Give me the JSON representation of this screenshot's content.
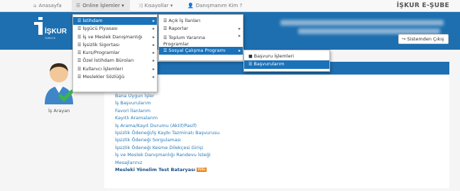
{
  "topnav": {
    "home": "Anasayfa",
    "online": "Online İşlemler",
    "shortcuts": "Kısayollar",
    "advisor": "Danışmanım Kim ?",
    "brand": "İŞKUR E-ŞUBE"
  },
  "header": {
    "logo_text": "İŞKUR",
    "logo_sub": "TÜRKİYE",
    "exit_label": "Sistemden Çıkış"
  },
  "user": {
    "caption": "İş Arayan"
  },
  "menu1": [
    {
      "label": "İstihdam",
      "active": true
    },
    {
      "label": "İşgücü Piyasası"
    },
    {
      "label": "İş ve Meslek Danışmanlığı"
    },
    {
      "label": "İşsizlik Sigortası"
    },
    {
      "label": "Kurs/Programlar"
    },
    {
      "label": "Özel İstihdam Büroları"
    },
    {
      "label": "Kullanıcı İşlemleri"
    },
    {
      "label": "Meslekler Sözlüğü"
    }
  ],
  "menu2": [
    {
      "label": "Açık İş İlanları"
    },
    {
      "label": "Raporlar"
    },
    {
      "label": "Toplum Yararına",
      "label2": "Programlar"
    },
    {
      "label": "Sosyal Çalışma Programı",
      "active": true
    }
  ],
  "menu3": [
    {
      "label": "Başvuru İşlemleri"
    },
    {
      "label": "Başvurularım",
      "active": true
    }
  ],
  "links": [
    "Bana Uygun İşler",
    "İş Başvurularım",
    "Favori İlanlarım",
    "Kayıtlı Aramalarım",
    "İş Arama/Kayıt Durumu (Aktif/Pasif)",
    "İşsizlik Ödeneği/İş Kaybı Tazminatı Başvurusu",
    "İşsizlik Ödeneği Sorgulaması",
    "İşsizlik Ödeneği Kesme Dilekçesi Girişi",
    "İş ve Meslek Danışmanlığı Randevu İsteği",
    "Mesajlarınız",
    "Mesleki Yönelim Test Bataryası"
  ],
  "badge": "ÖZEL",
  "colors": {
    "header": "#1d6fb0",
    "active": "#1a72b9",
    "link": "#2a7ab8"
  }
}
